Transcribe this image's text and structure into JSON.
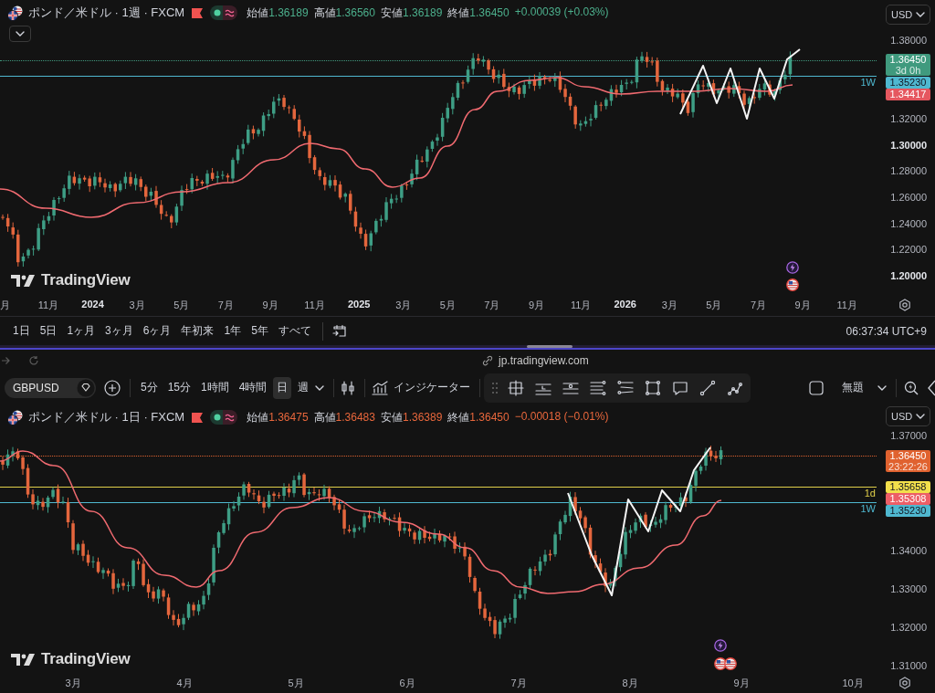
{
  "top_chart": {
    "legend": {
      "title": "ポンド／米ドル · 1週 · FXCM",
      "fields": [
        {
          "label": "始値",
          "value": "1.36189"
        },
        {
          "label": "高値",
          "value": "1.36560"
        },
        {
          "label": "安値",
          "value": "1.36189"
        },
        {
          "label": "終値",
          "value": "1.36450"
        }
      ],
      "change": "+0.00039 (+0.03%)",
      "rising": true,
      "collapse_button": true
    },
    "currency": "USD",
    "price_ticks": [
      {
        "text": "1.38000",
        "kind": "minor"
      },
      {
        "text": "1.32000",
        "kind": "minor"
      },
      {
        "text": "1.30000",
        "kind": "major"
      },
      {
        "text": "1.28000",
        "kind": "minor"
      },
      {
        "text": "1.26000",
        "kind": "minor"
      },
      {
        "text": "1.24000",
        "kind": "minor"
      },
      {
        "text": "1.22000",
        "kind": "minor"
      },
      {
        "text": "1.20000",
        "kind": "major"
      }
    ],
    "price_labels": [
      {
        "price": "1.36450",
        "countdown": "3d 0h",
        "color": "#409a7e"
      },
      {
        "price": "1.35230",
        "color": "#4fb8d0"
      },
      {
        "price": "1.34417",
        "color": "#e5575f"
      }
    ],
    "line_labels": [
      {
        "text": "1W",
        "color": "#4fb8d0"
      }
    ],
    "logo": "TradingView",
    "time_ticks": [
      {
        "text": "月",
        "kind": "month"
      },
      {
        "text": "11月",
        "kind": "month"
      },
      {
        "text": "2024",
        "kind": "year"
      },
      {
        "text": "3月",
        "kind": "month"
      },
      {
        "text": "5月",
        "kind": "month"
      },
      {
        "text": "7月",
        "kind": "month"
      },
      {
        "text": "9月",
        "kind": "month"
      },
      {
        "text": "11月",
        "kind": "month"
      },
      {
        "text": "2025",
        "kind": "year"
      },
      {
        "text": "3月",
        "kind": "month"
      },
      {
        "text": "5月",
        "kind": "month"
      },
      {
        "text": "7月",
        "kind": "month"
      },
      {
        "text": "9月",
        "kind": "month"
      },
      {
        "text": "11月",
        "kind": "month"
      },
      {
        "text": "2026",
        "kind": "year"
      },
      {
        "text": "3月",
        "kind": "month"
      },
      {
        "text": "5月",
        "kind": "month"
      },
      {
        "text": "7月",
        "kind": "month"
      },
      {
        "text": "9月",
        "kind": "month"
      },
      {
        "text": "11月",
        "kind": "month"
      }
    ]
  },
  "range_bar": {
    "ranges": [
      "1日",
      "5日",
      "1ヶ月",
      "3ヶ月",
      "6ヶ月",
      "年初来",
      "1年",
      "5年",
      "すべて"
    ],
    "clock": "06:37:34 UTC+9"
  },
  "browser_bar": {
    "url": "jp.tradingview.com"
  },
  "toolbar": {
    "symbol": "GBPUSD",
    "intervals": [
      {
        "label": "5分",
        "selected": false
      },
      {
        "label": "15分",
        "selected": false
      },
      {
        "label": "1時間",
        "selected": false
      },
      {
        "label": "4時間",
        "selected": false
      },
      {
        "label": "日",
        "selected": true
      },
      {
        "label": "週",
        "selected": false
      }
    ],
    "indicators": "インジケーター",
    "layout_name": "無題"
  },
  "bottom_chart": {
    "legend": {
      "title": "ポンド／米ドル · 1日 · FXCM",
      "fields": [
        {
          "label": "始値",
          "value": "1.36475"
        },
        {
          "label": "高値",
          "value": "1.36483"
        },
        {
          "label": "安値",
          "value": "1.36389"
        },
        {
          "label": "終値",
          "value": "1.36450"
        }
      ],
      "change": "−0.00018 (−0.01%)",
      "rising": false,
      "collapse_button": false
    },
    "currency": "USD",
    "price_ticks": [
      {
        "text": "1.37000",
        "kind": "minor"
      },
      {
        "text": "1.34000",
        "kind": "minor"
      },
      {
        "text": "1.33000",
        "kind": "minor"
      },
      {
        "text": "1.32000",
        "kind": "minor"
      },
      {
        "text": "1.31000",
        "kind": "minor"
      }
    ],
    "price_labels": [
      {
        "price": "1.36450",
        "countdown": "23:22:26",
        "color": "#e0622f"
      },
      {
        "price": "1.35658",
        "color": "#f2df4b"
      },
      {
        "price": "1.35308",
        "color": "#ec5e66"
      },
      {
        "price": "1.35230",
        "color": "#4fb8d0"
      }
    ],
    "line_labels": [
      {
        "text": "1d",
        "color": "#e0cf4a"
      },
      {
        "text": "1W",
        "color": "#4fb8d0"
      }
    ],
    "logo": "TradingView",
    "time_ticks": [
      {
        "text": "3月",
        "kind": "month"
      },
      {
        "text": "4月",
        "kind": "month"
      },
      {
        "text": "5月",
        "kind": "month"
      },
      {
        "text": "6月",
        "kind": "month"
      },
      {
        "text": "7月",
        "kind": "month"
      },
      {
        "text": "8月",
        "kind": "month"
      },
      {
        "text": "9月",
        "kind": "month"
      },
      {
        "text": "10月",
        "kind": "month"
      }
    ]
  }
}
